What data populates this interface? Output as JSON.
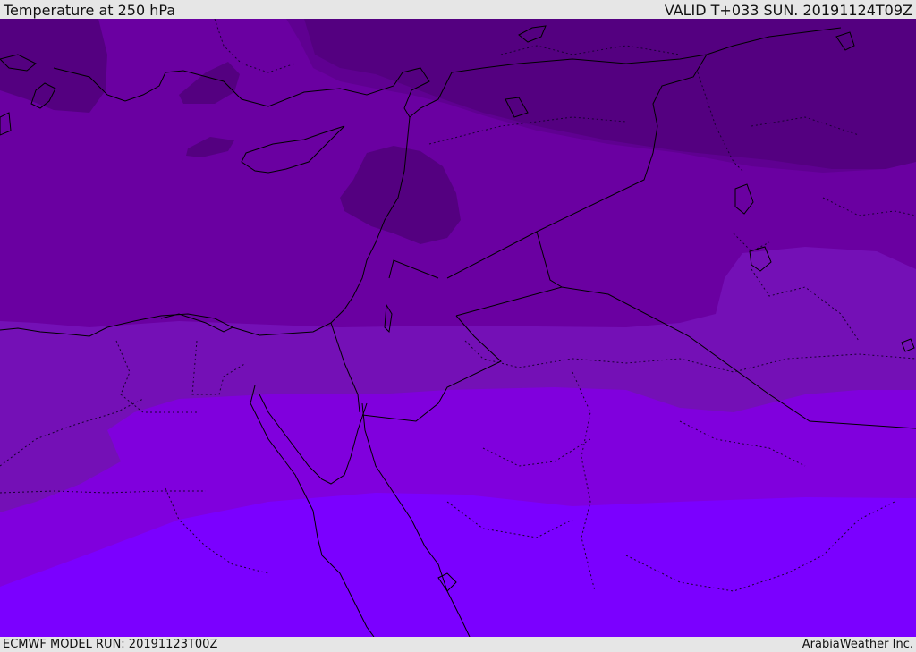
{
  "header": {
    "title": "Temperature at 250 hPa",
    "valid_time": "VALID T+033 SUN. 20191124T09Z"
  },
  "footer": {
    "model_run": "ECMWF MODEL RUN: 20191123T00Z",
    "credit": "ArabiaWeather Inc."
  },
  "map": {
    "colors": {
      "band_darkest": "#540080",
      "band_dark": "#5f0091",
      "band_mid": "#6a00a1",
      "band_light_mid": "#7410b6",
      "band_light": "#8000dd",
      "band_lightest": "#7b00ff",
      "coastline": "#000000",
      "border": "#1a0033"
    }
  }
}
